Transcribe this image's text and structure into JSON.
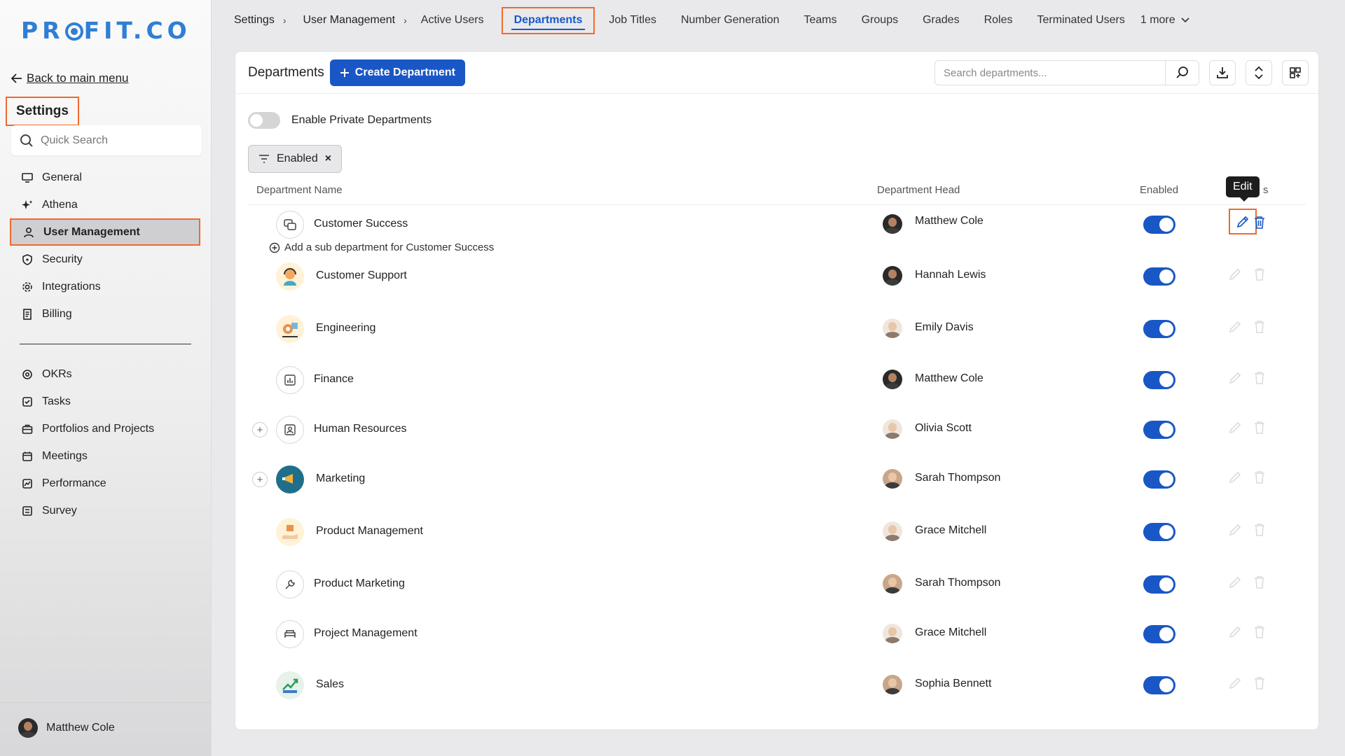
{
  "brand": {
    "logo_text": "PROFIT.CO"
  },
  "sidebar": {
    "back_label": "Back to main menu",
    "title": "Settings",
    "search_placeholder": "Quick Search",
    "items_top": [
      {
        "label": "General",
        "icon": "monitor-icon"
      },
      {
        "label": "Athena",
        "icon": "sparkle-icon"
      },
      {
        "label": "User Management",
        "icon": "user-icon",
        "active": true
      },
      {
        "label": "Security",
        "icon": "shield-icon"
      },
      {
        "label": "Integrations",
        "icon": "gear-icon"
      },
      {
        "label": "Billing",
        "icon": "receipt-icon"
      }
    ],
    "items_bottom": [
      {
        "label": "OKRs",
        "icon": "target-icon"
      },
      {
        "label": "Tasks",
        "icon": "checkbox-icon"
      },
      {
        "label": "Portfolios and Projects",
        "icon": "briefcase-icon"
      },
      {
        "label": "Meetings",
        "icon": "calendar-icon"
      },
      {
        "label": "Performance",
        "icon": "chart-icon"
      },
      {
        "label": "Survey",
        "icon": "survey-icon"
      }
    ],
    "user_name": "Matthew Cole"
  },
  "topbar": {
    "breadcrumbs": [
      "Settings",
      "User Management"
    ],
    "tabs": [
      "Active Users",
      "Departments",
      "Job Titles",
      "Number Generation",
      "Teams",
      "Groups",
      "Grades",
      "Roles",
      "Terminated Users"
    ],
    "active_tab": "Departments",
    "more_label": "1 more"
  },
  "page": {
    "title": "Departments",
    "create_label": "Create Department",
    "search_placeholder": "Search departments...",
    "private_toggle_label": "Enable Private Departments",
    "filter_chip": "Enabled",
    "filter_close": "×",
    "columns": {
      "name": "Department Name",
      "head": "Department Head",
      "enabled": "Enabled",
      "actions_tail": "s"
    },
    "tooltip": "Edit",
    "add_sub_label": "Add a sub department for Customer Success"
  },
  "departments": [
    {
      "name": "Customer Success",
      "head": "Matthew Cole",
      "enabled": true,
      "icon": "chat-icon"
    },
    {
      "name": "Customer Support",
      "head": "Hannah Lewis",
      "enabled": true,
      "icon": "support-agent-icon"
    },
    {
      "name": "Engineering",
      "head": "Emily Davis",
      "enabled": true,
      "icon": "engineering-icon"
    },
    {
      "name": "Finance",
      "head": "Matthew Cole",
      "enabled": true,
      "icon": "bar-chart-icon"
    },
    {
      "name": "Human Resources",
      "head": "Olivia Scott",
      "enabled": true,
      "icon": "id-badge-icon",
      "expandable": true
    },
    {
      "name": "Marketing",
      "head": "Sarah Thompson",
      "enabled": true,
      "icon": "megaphone-icon",
      "expandable": true
    },
    {
      "name": "Product Management",
      "head": "Grace Mitchell",
      "enabled": true,
      "icon": "product-hand-icon"
    },
    {
      "name": "Product Marketing",
      "head": "Sarah Thompson",
      "enabled": true,
      "icon": "wrench-icon"
    },
    {
      "name": "Project Management",
      "head": "Grace Mitchell",
      "enabled": true,
      "icon": "bed-icon"
    },
    {
      "name": "Sales",
      "head": "Sophia Bennett",
      "enabled": true,
      "icon": "sales-growth-icon"
    }
  ],
  "colors": {
    "accent": "#1a57c6",
    "highlight": "#f06a2d",
    "logo": "#2f7fd4"
  }
}
